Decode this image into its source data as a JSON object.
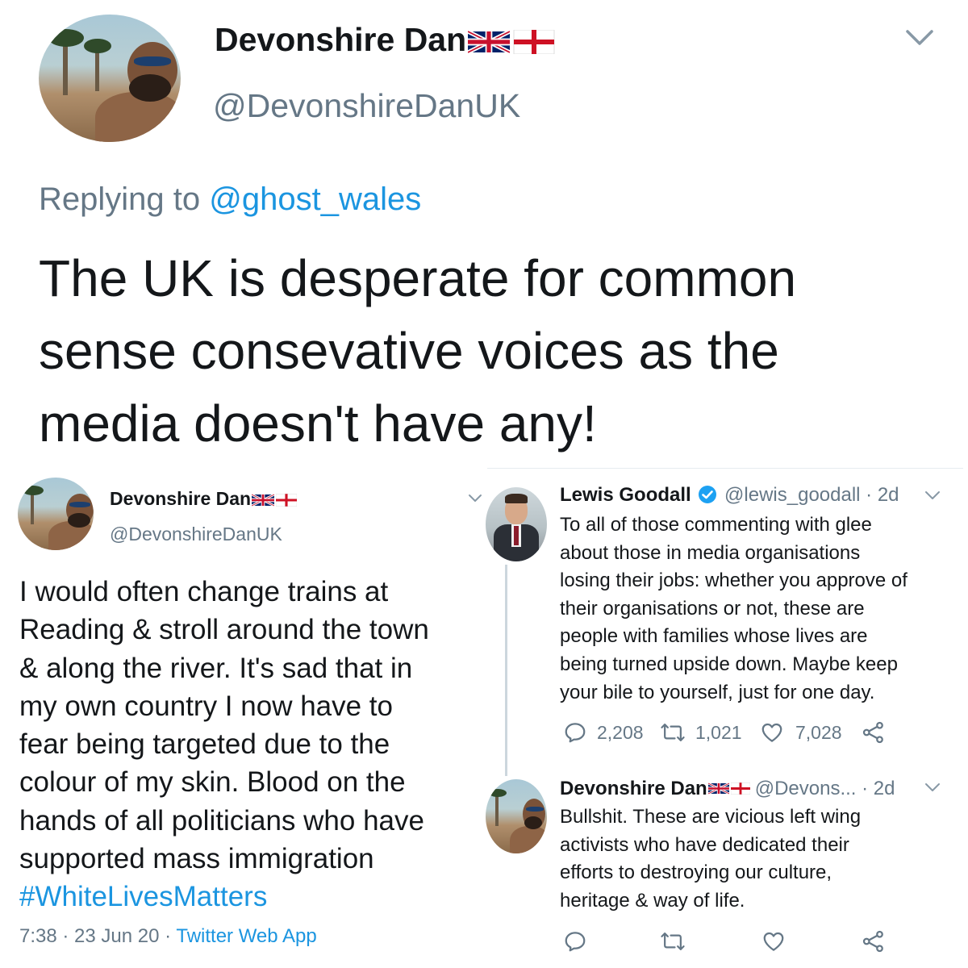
{
  "main_tweet": {
    "display_name": "Devonshire Dan",
    "handle": "@DevonshireDanUK",
    "replying_prefix": "Replying to ",
    "replying_to": "@ghost_wales",
    "text_line1": "The UK is desperate for common",
    "text_line2": "sense consevative voices as the",
    "text_line3": "media doesn't have any!"
  },
  "left_tweet": {
    "display_name": "Devonshire Dan",
    "handle": "@DevonshireDanUK",
    "lines": [
      "I would often change trains at",
      "Reading & stroll around the town",
      "& along the river. It's sad that in",
      "my own country I now have to",
      "fear being targeted due to the",
      "colour of my skin. Blood on the",
      "hands of all politicians who have",
      "supported mass immigration"
    ],
    "hashtag": "#WhiteLivesMatters",
    "timestamp": "7:38 · 23 Jun 20 · ",
    "source": "Twitter Web App"
  },
  "lewis_tweet": {
    "display_name": "Lewis Goodall",
    "handle_time": "@lewis_goodall · 2d",
    "lines": [
      "To all of those commenting with glee",
      "about those in media organisations",
      "losing their jobs: whether you approve of",
      "their organisations or not, these are",
      "people with families whose lives are",
      "being turned upside down. Maybe keep",
      "your bile to yourself, just for one day."
    ],
    "replies": "2,208",
    "retweets": "1,021",
    "likes": "7,028"
  },
  "dan_reply": {
    "display_name": "Devonshire Dan",
    "handle_time": "@Devons... · 2d",
    "lines": [
      "Bullshit. These are vicious left wing",
      "activists who have dedicated their",
      "efforts to destroying our culture,",
      "heritage & way of life."
    ]
  },
  "colors": {
    "text": "#14171a",
    "muted": "#657786",
    "link": "#1b95e0",
    "verified": "#1da1f2",
    "divider": "#e6ecf0"
  },
  "icons": [
    "chevron-down-icon",
    "uk-flag-icon",
    "england-flag-icon",
    "verified-badge-icon",
    "reply-icon",
    "retweet-icon",
    "like-icon",
    "share-icon"
  ]
}
